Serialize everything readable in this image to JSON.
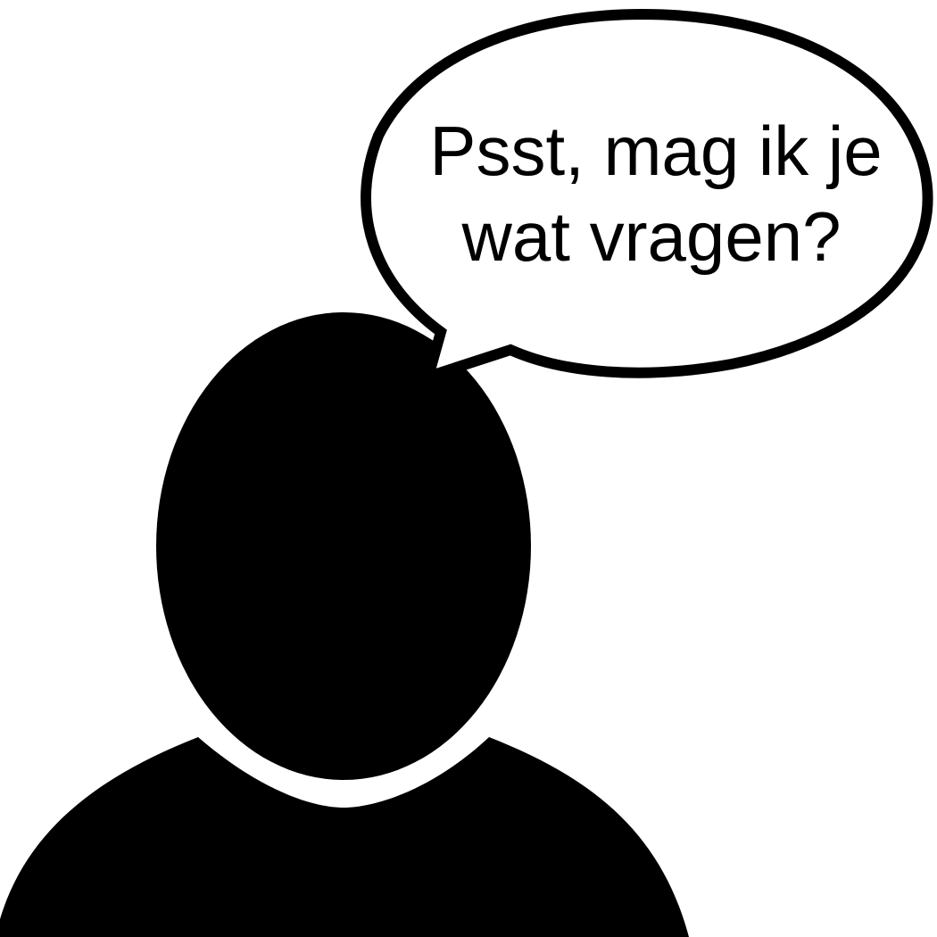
{
  "speech_bubble": {
    "line1": "Psst, mag ik je",
    "line2": "wat vragen?"
  },
  "colors": {
    "background": "#ffffff",
    "silhouette": "#000000",
    "bubble_fill": "#ffffff",
    "bubble_stroke": "#000000",
    "text": "#000000"
  },
  "icons": {
    "person": "person-silhouette-icon"
  }
}
